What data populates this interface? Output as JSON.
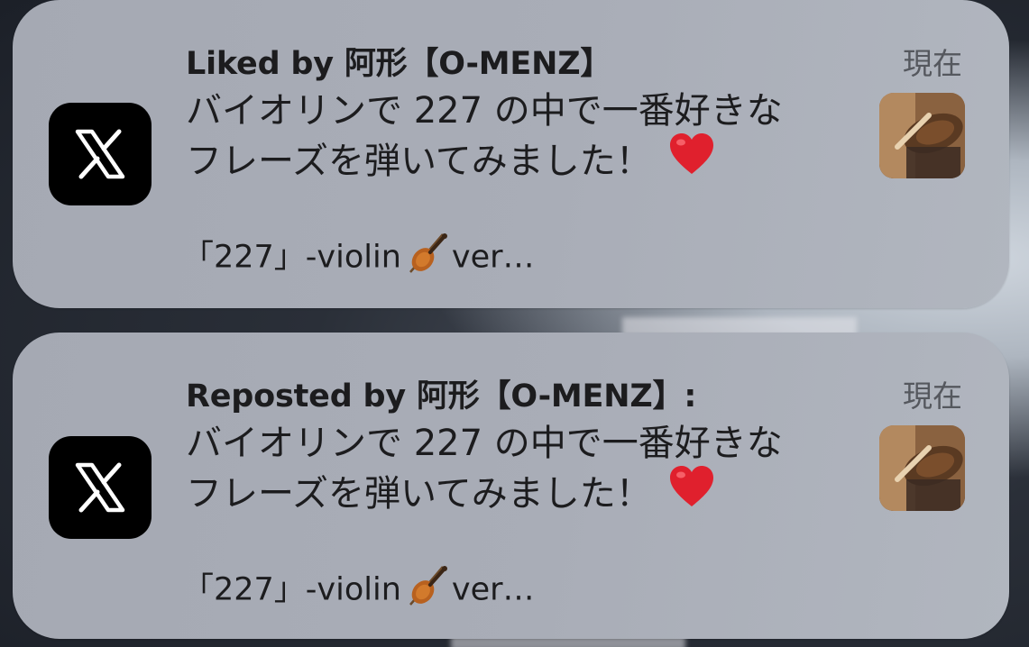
{
  "notifications": [
    {
      "app_icon": "x-logo-icon",
      "title": "Liked by 阿形【O-MENZ】",
      "time": "現在",
      "body_line1": "バイオリンで 227 の中で一番好きな",
      "body_line2": "フレーズを弾いてみました！",
      "heart": "heart-icon",
      "snippet_prefix": "「227」-violin",
      "snippet_suffix": "ver…",
      "thumbnail": "violin-thumbnail"
    },
    {
      "app_icon": "x-logo-icon",
      "title": "Reposted by 阿形【O-MENZ】:",
      "time": "現在",
      "body_line1": "バイオリンで 227 の中で一番好きな",
      "body_line2": "フレーズを弾いてみました！",
      "heart": "heart-icon",
      "snippet_prefix": "「227」-violin",
      "snippet_suffix": "ver…",
      "thumbnail": "violin-thumbnail"
    }
  ],
  "colors": {
    "card_background": "#a9adb7",
    "text_primary": "#1c1c1e",
    "text_secondary": "#55585e",
    "heart": "#e0202d",
    "app_icon_bg": "#000000"
  }
}
